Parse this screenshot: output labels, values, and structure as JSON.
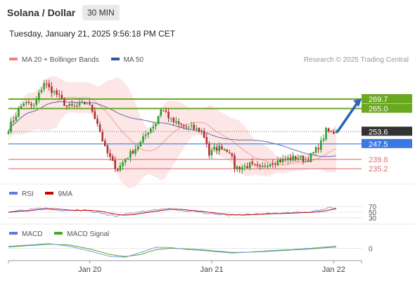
{
  "header": {
    "title": "Solana / Dollar",
    "timeframe": "30 MIN",
    "timestamp": "Tuesday, January 21, 2025 9:56:18 PM CET",
    "credit": "Research © 2025 Trading Central"
  },
  "legends": {
    "price": [
      {
        "label": "MA 20 + Bollinger Bands",
        "color": "#f08080"
      },
      {
        "label": "MA 50",
        "color": "#2c5aa0"
      }
    ],
    "rsi": [
      {
        "label": "RSI",
        "color": "#5b7fd6"
      },
      {
        "label": "9MA",
        "color": "#cc0000"
      }
    ],
    "macd": [
      {
        "label": "MACD",
        "color": "#5b7fd6"
      },
      {
        "label": "MACD Signal",
        "color": "#4aa82a"
      }
    ]
  },
  "colors": {
    "up": "#2e9e2e",
    "down": "#b03030",
    "band_fill": "#fde2e2",
    "ma20": "#f0a0a0",
    "ma50": "#5b6fb0",
    "resistance": "#6aa820",
    "pivot": "#3b78e0",
    "support": "#e07070",
    "arrow": "#2a64b8",
    "current": "#333333"
  },
  "chart_data": [
    {
      "type": "candlestick",
      "name": "price",
      "ylim": [
        229,
        285
      ],
      "x_ticks": [
        {
          "label": "Jan 20",
          "index": 32
        },
        {
          "label": "Jan 21",
          "index": 80
        },
        {
          "label": "Jan 22",
          "index": 128
        }
      ],
      "levels": [
        {
          "label": "269.7",
          "value": 269.7,
          "kind": "resistance"
        },
        {
          "label": "265.0",
          "value": 265.0,
          "kind": "resistance"
        },
        {
          "label": "253.6",
          "value": 253.6,
          "kind": "current"
        },
        {
          "label": "247.5",
          "value": 247.5,
          "kind": "pivot"
        },
        {
          "label": "239.8",
          "value": 239.8,
          "kind": "support"
        },
        {
          "label": "235.2",
          "value": 235.2,
          "kind": "support"
        }
      ],
      "close_anchors": [
        [
          0,
          255
        ],
        [
          3,
          262
        ],
        [
          6,
          268
        ],
        [
          10,
          266
        ],
        [
          14,
          278
        ],
        [
          16,
          275
        ],
        [
          19,
          272
        ],
        [
          23,
          266
        ],
        [
          27,
          266
        ],
        [
          31,
          268
        ],
        [
          33,
          264
        ],
        [
          35,
          258
        ],
        [
          38,
          245
        ],
        [
          41,
          238
        ],
        [
          43,
          235
        ],
        [
          46,
          240
        ],
        [
          49,
          244
        ],
        [
          52,
          248
        ],
        [
          55,
          254
        ],
        [
          58,
          258
        ],
        [
          60,
          265
        ],
        [
          62,
          263
        ],
        [
          64,
          259
        ],
        [
          67,
          257
        ],
        [
          70,
          256
        ],
        [
          73,
          255
        ],
        [
          76,
          254
        ],
        [
          78,
          248
        ],
        [
          79,
          242
        ],
        [
          81,
          245
        ],
        [
          84,
          246
        ],
        [
          87,
          244
        ],
        [
          89,
          236
        ],
        [
          92,
          236
        ],
        [
          95,
          237
        ],
        [
          99,
          235
        ],
        [
          102,
          238
        ],
        [
          106,
          239
        ],
        [
          110,
          240
        ],
        [
          114,
          241
        ],
        [
          117,
          239
        ],
        [
          120,
          243
        ],
        [
          123,
          248
        ],
        [
          125,
          254
        ],
        [
          127,
          253
        ],
        [
          129,
          253.6
        ]
      ],
      "forecast": {
        "from_index": 129,
        "from_value": 253.6,
        "to_value": 269.7
      }
    },
    {
      "type": "line",
      "name": "rsi",
      "levels": [
        {
          "label": "70",
          "value": 70
        },
        {
          "label": "50",
          "value": 50
        },
        {
          "label": "30",
          "value": 30
        }
      ],
      "ylim": [
        20,
        80
      ],
      "rsi_anchors": [
        [
          0,
          52
        ],
        [
          8,
          60
        ],
        [
          14,
          66
        ],
        [
          22,
          55
        ],
        [
          30,
          58
        ],
        [
          36,
          46
        ],
        [
          42,
          36
        ],
        [
          50,
          48
        ],
        [
          56,
          56
        ],
        [
          62,
          62
        ],
        [
          68,
          55
        ],
        [
          74,
          52
        ],
        [
          78,
          46
        ],
        [
          82,
          44
        ],
        [
          88,
          38
        ],
        [
          94,
          42
        ],
        [
          100,
          44
        ],
        [
          106,
          46
        ],
        [
          112,
          48
        ],
        [
          118,
          50
        ],
        [
          122,
          58
        ],
        [
          126,
          66
        ],
        [
          129,
          62
        ]
      ]
    },
    {
      "type": "line",
      "name": "macd",
      "levels": [
        {
          "label": "0",
          "value": 0
        }
      ],
      "ylim": [
        -8,
        8
      ],
      "macd_anchors": [
        [
          0,
          1.5
        ],
        [
          8,
          2.5
        ],
        [
          16,
          3.5
        ],
        [
          24,
          1.5
        ],
        [
          32,
          -2
        ],
        [
          40,
          -6
        ],
        [
          46,
          -6.5
        ],
        [
          52,
          -3
        ],
        [
          58,
          0.8
        ],
        [
          64,
          0.5
        ],
        [
          70,
          -0.8
        ],
        [
          76,
          -1.5
        ],
        [
          82,
          -2.5
        ],
        [
          88,
          -3.5
        ],
        [
          96,
          -2.6
        ],
        [
          104,
          -1.5
        ],
        [
          112,
          -0.8
        ],
        [
          120,
          0.2
        ],
        [
          126,
          1.2
        ],
        [
          129,
          1.5
        ]
      ],
      "signal_anchors": [
        [
          0,
          1
        ],
        [
          8,
          2
        ],
        [
          16,
          3
        ],
        [
          24,
          2.5
        ],
        [
          32,
          -0.5
        ],
        [
          40,
          -4.5
        ],
        [
          46,
          -6
        ],
        [
          52,
          -4.5
        ],
        [
          58,
          -1
        ],
        [
          64,
          0
        ],
        [
          70,
          -0.4
        ],
        [
          76,
          -1
        ],
        [
          82,
          -2
        ],
        [
          88,
          -3
        ],
        [
          96,
          -2.8
        ],
        [
          104,
          -2
        ],
        [
          112,
          -1.2
        ],
        [
          120,
          -0.3
        ],
        [
          126,
          0.6
        ],
        [
          129,
          0.9
        ]
      ]
    }
  ]
}
